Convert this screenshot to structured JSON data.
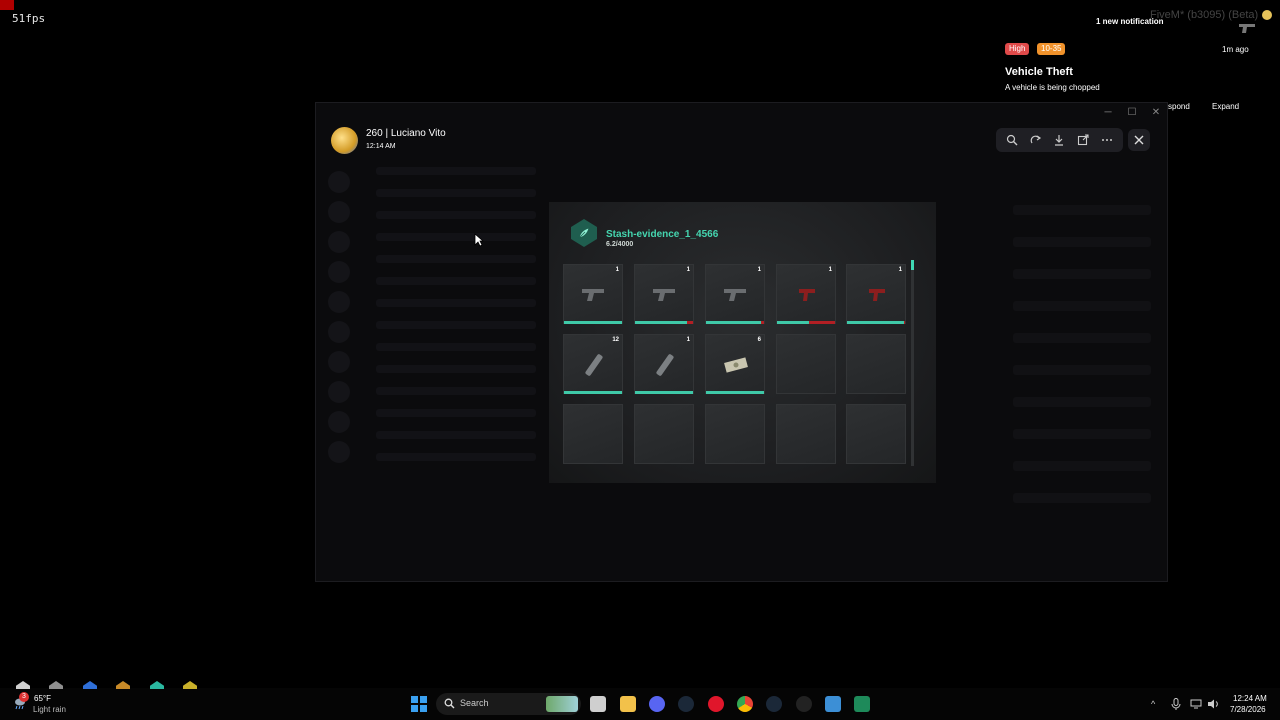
{
  "overlay": {
    "fps": "51fps"
  },
  "fivem": {
    "title": "FiveM* (b3095) (Beta)"
  },
  "notification": {
    "count_text": "1 new notification",
    "priority": "High",
    "code": "10-35",
    "time_ago": "1m ago",
    "title": "Vehicle Theft",
    "description": "A vehicle is being chopped",
    "respond_label": "spond",
    "expand_label": "Expand",
    "colors": {
      "priority": "#e04a4a",
      "code": "#f0922b"
    }
  },
  "viewer": {
    "user": "260 | Luciano Vito",
    "timestamp": "12:14 AM",
    "tools": [
      "zoom-icon",
      "rotate-icon",
      "download-icon",
      "open-external-icon",
      "more-icon"
    ]
  },
  "inventory": {
    "title": "Stash-evidence_1_4566",
    "weight": "6.2/4000",
    "accent": "#45d6b0",
    "slots": [
      {
        "count": "1",
        "item": "pistol-icon",
        "durability": 1.0
      },
      {
        "count": "1",
        "item": "pistol-icon",
        "durability": 0.9
      },
      {
        "count": "1",
        "item": "pistol-icon",
        "durability": 0.95
      },
      {
        "count": "1",
        "item": "red-pistol-icon",
        "durability": 0.55
      },
      {
        "count": "1",
        "item": "red-pistol-icon",
        "durability": 0.98
      },
      {
        "count": "12",
        "item": "magazine-icon",
        "durability": 1.0
      },
      {
        "count": "1",
        "item": "magazine-icon",
        "durability": 1.0
      },
      {
        "count": "6",
        "item": "cash-icon",
        "durability": 1.0
      },
      {
        "count": "",
        "item": "",
        "durability": null
      },
      {
        "count": "",
        "item": "",
        "durability": null
      },
      {
        "count": "",
        "item": "",
        "durability": null
      },
      {
        "count": "",
        "item": "",
        "durability": null
      },
      {
        "count": "",
        "item": "",
        "durability": null
      },
      {
        "count": "",
        "item": "",
        "durability": null
      },
      {
        "count": "",
        "item": "",
        "durability": null
      }
    ]
  },
  "taskbar": {
    "weather": {
      "badge": "3",
      "temp": "65°F",
      "desc": "Light rain"
    },
    "search_label": "Search",
    "clock": {
      "time": "12:24 AM",
      "date": "7/28/2026"
    },
    "pinned": [
      "file-explorer-icon",
      "folder-icon",
      "discord-icon",
      "steam-icon",
      "opera-icon",
      "chrome-icon",
      "steam-icon",
      "obs-icon",
      "snipping-tool-icon",
      "terminal-icon"
    ]
  }
}
